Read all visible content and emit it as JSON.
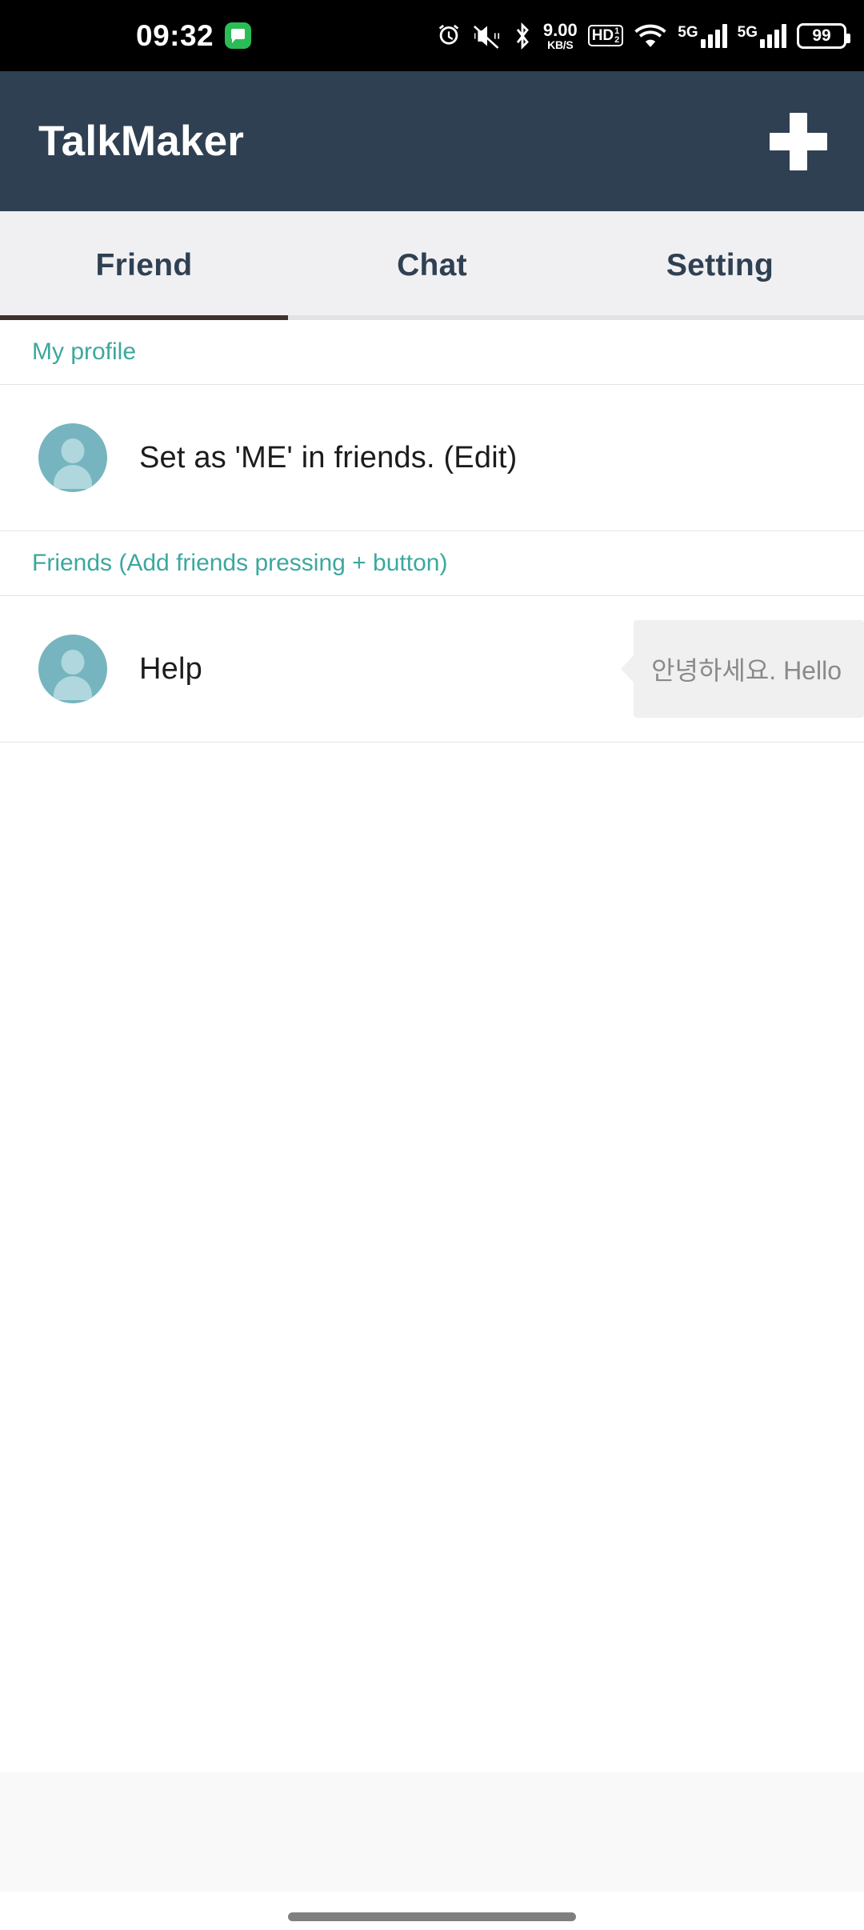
{
  "status_bar": {
    "time": "09:32",
    "network_speed": "9.00",
    "network_speed_unit": "KB/S",
    "hd_label": "HD",
    "hd_sup": "1",
    "hd_sub": "2",
    "sim1_network": "5G",
    "sim2_network": "5G",
    "battery_level": "99",
    "icons": [
      "message-icon",
      "alarm-icon",
      "mute-icon",
      "bluetooth-icon",
      "network-speed-icon",
      "hd-voice-icon",
      "wifi-icon",
      "signal-icon",
      "battery-icon"
    ],
    "background": "#000000",
    "foreground": "#FFFFFF"
  },
  "app_bar": {
    "title": "TalkMaker",
    "add_button_label": "+",
    "background": "#2F4052",
    "title_color": "#FFFFFF"
  },
  "tabs": {
    "active_index": 0,
    "indicator_color": "#40312F",
    "background": "#F0F0F2",
    "label_color": "#2F4052",
    "items": [
      {
        "label": "Friend"
      },
      {
        "label": "Chat"
      },
      {
        "label": "Setting"
      }
    ]
  },
  "sections": [
    {
      "header": "My profile",
      "header_color": "#3CA89E",
      "rows": [
        {
          "name": "Set as 'ME' in friends. (Edit)",
          "avatar": "person-placeholder-avatar",
          "message": null
        }
      ]
    },
    {
      "header": "Friends (Add friends pressing + button)",
      "header_color": "#3CA89E",
      "rows": [
        {
          "name": "Help",
          "avatar": "person-placeholder-avatar",
          "message": "안녕하세요. Hello"
        }
      ]
    }
  ],
  "bottom": {
    "band_color": "#F9F9F9",
    "gesture_bar_color": "#7F7F7F"
  },
  "colors": {
    "accent_teal": "#3CA89E",
    "avatar_teal": "#76B5BF",
    "avatar_figure": "#AFD7DD",
    "bubble_bg": "#F0F0F0",
    "bubble_text": "#8A8A8A",
    "divider": "#E4E4E4"
  }
}
